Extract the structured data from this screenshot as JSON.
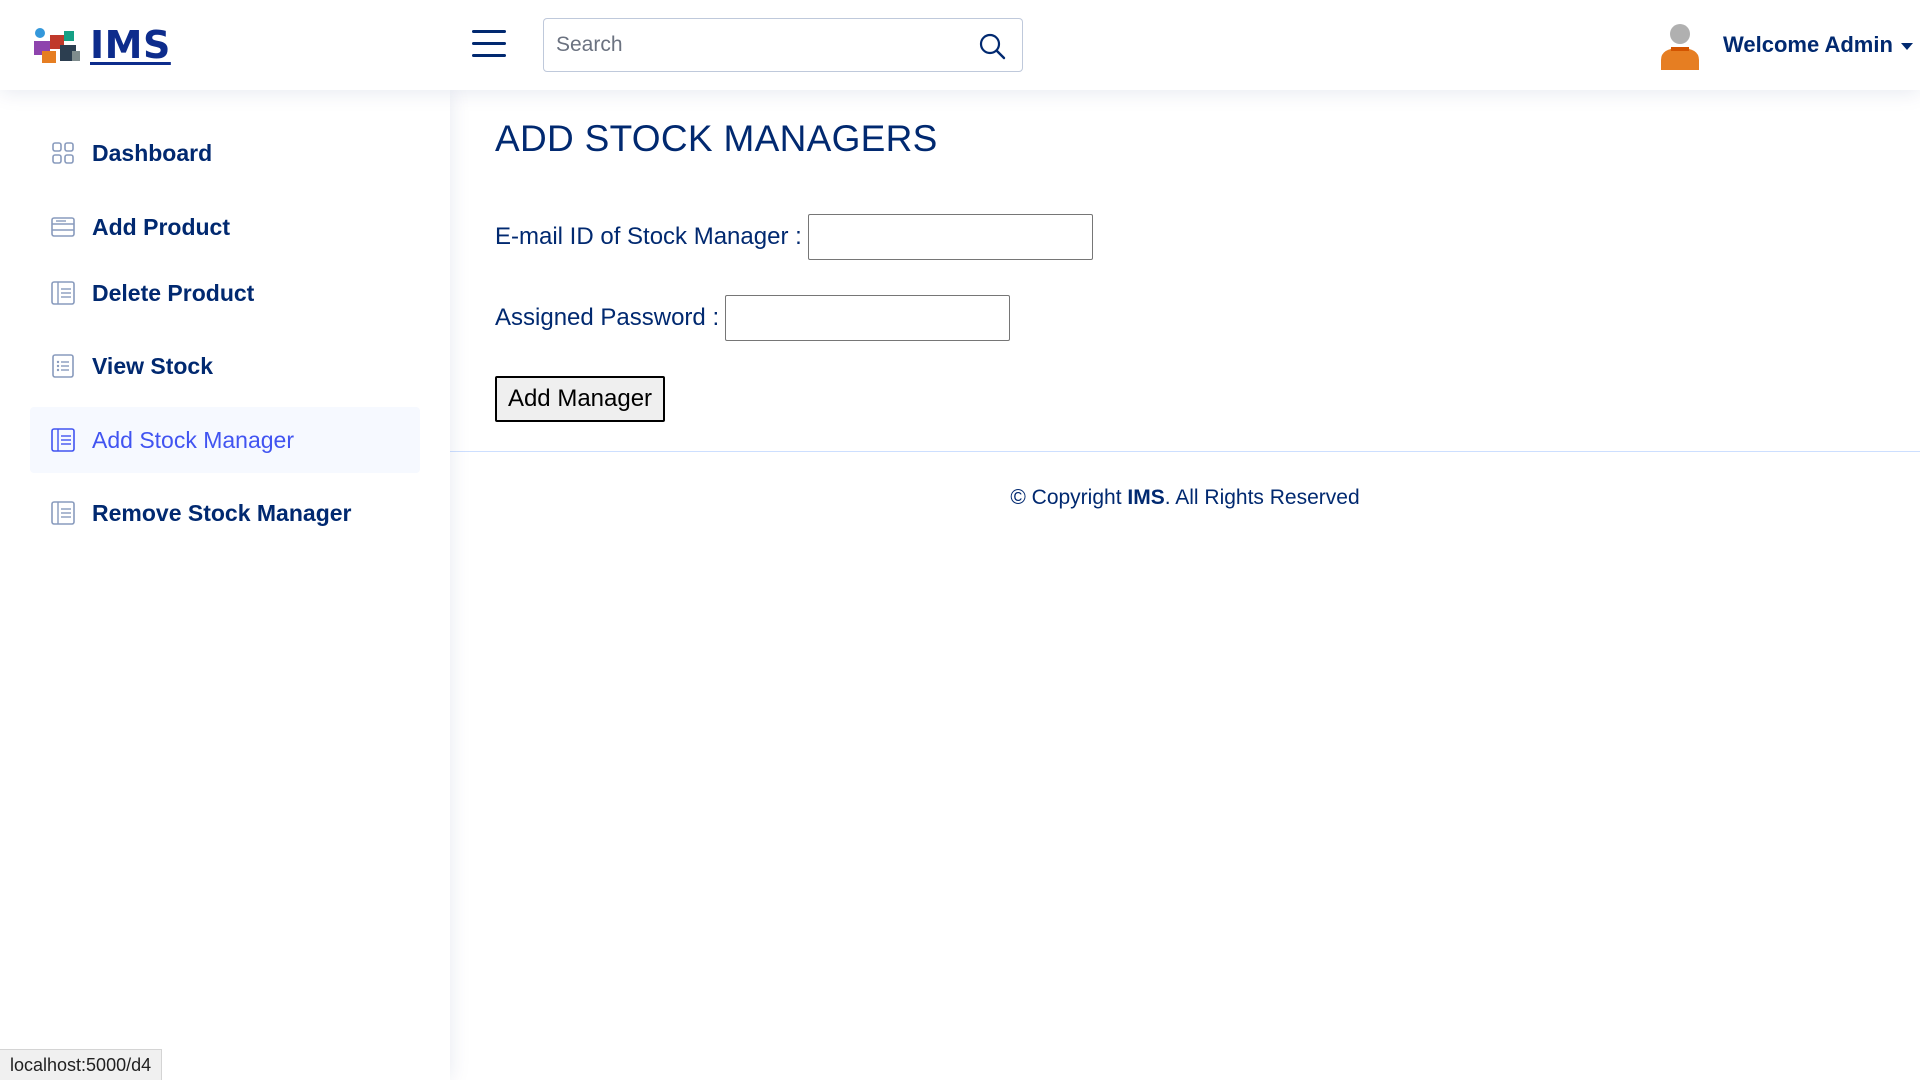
{
  "header": {
    "logo_text": "IMS",
    "search_placeholder": "Search",
    "search_value": "",
    "welcome_text": "Welcome Admin"
  },
  "sidebar": {
    "items": [
      {
        "label": "Dashboard",
        "icon": "grid-icon",
        "active": false
      },
      {
        "label": "Add Product",
        "icon": "layout-text-icon",
        "active": false
      },
      {
        "label": "Delete Product",
        "icon": "table-icon",
        "active": false
      },
      {
        "label": "View Stock",
        "icon": "list-icon",
        "active": false
      },
      {
        "label": "Add Stock Manager",
        "icon": "table-icon",
        "active": true
      },
      {
        "label": "Remove Stock Manager",
        "icon": "table-icon",
        "active": false
      }
    ]
  },
  "main": {
    "title": "ADD STOCK MANAGERS",
    "email_label": "E-mail ID of Stock Manager :",
    "email_value": "",
    "password_label": "Assigned Password :",
    "password_value": "",
    "submit_label": "Add Manager"
  },
  "footer": {
    "prefix": "© Copyright ",
    "brand": "IMS",
    "suffix": ". All Rights Reserved"
  },
  "status_bar": {
    "url": "localhost:5000/d4"
  },
  "colors": {
    "primary_text": "#012970",
    "active_accent": "#4154f1",
    "active_bg": "#f6f9ff",
    "avatar_body": "#e67e22",
    "avatar_head": "#b0b0b0"
  }
}
